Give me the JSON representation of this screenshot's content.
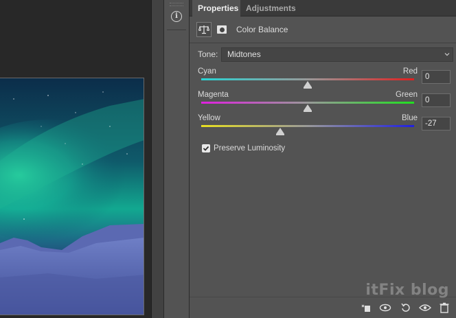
{
  "tabs": {
    "properties": "Properties",
    "adjustments": "Adjustments"
  },
  "adjustment": {
    "title": "Color Balance",
    "icon": "balance-scales-icon",
    "mask_icon": "layer-mask-icon"
  },
  "tone": {
    "label": "Tone:",
    "value": "Midtones"
  },
  "sliders": [
    {
      "left": "Cyan",
      "right": "Red",
      "value": "0",
      "level": 0.5,
      "from": "#27d5d5",
      "to": "#e02020"
    },
    {
      "left": "Magenta",
      "right": "Green",
      "value": "0",
      "level": 0.5,
      "from": "#e020e0",
      "to": "#20e020"
    },
    {
      "left": "Yellow",
      "right": "Blue",
      "value": "-27",
      "level": 0.37,
      "from": "#e8e020",
      "to": "#2020e0"
    }
  ],
  "preserve": {
    "label": "Preserve Luminosity",
    "checked": true
  },
  "bottom_icons": [
    "clip-to-layer-icon",
    "view-previous-icon",
    "reset-icon",
    "visibility-eye-icon",
    "trash-icon"
  ],
  "side_strip": {
    "icon": "info-icon"
  },
  "watermark": "itFix blog",
  "colors": {
    "panel_bg": "#535353",
    "tabbar_bg": "#3a3a3a",
    "canvas_bg": "#282828"
  }
}
